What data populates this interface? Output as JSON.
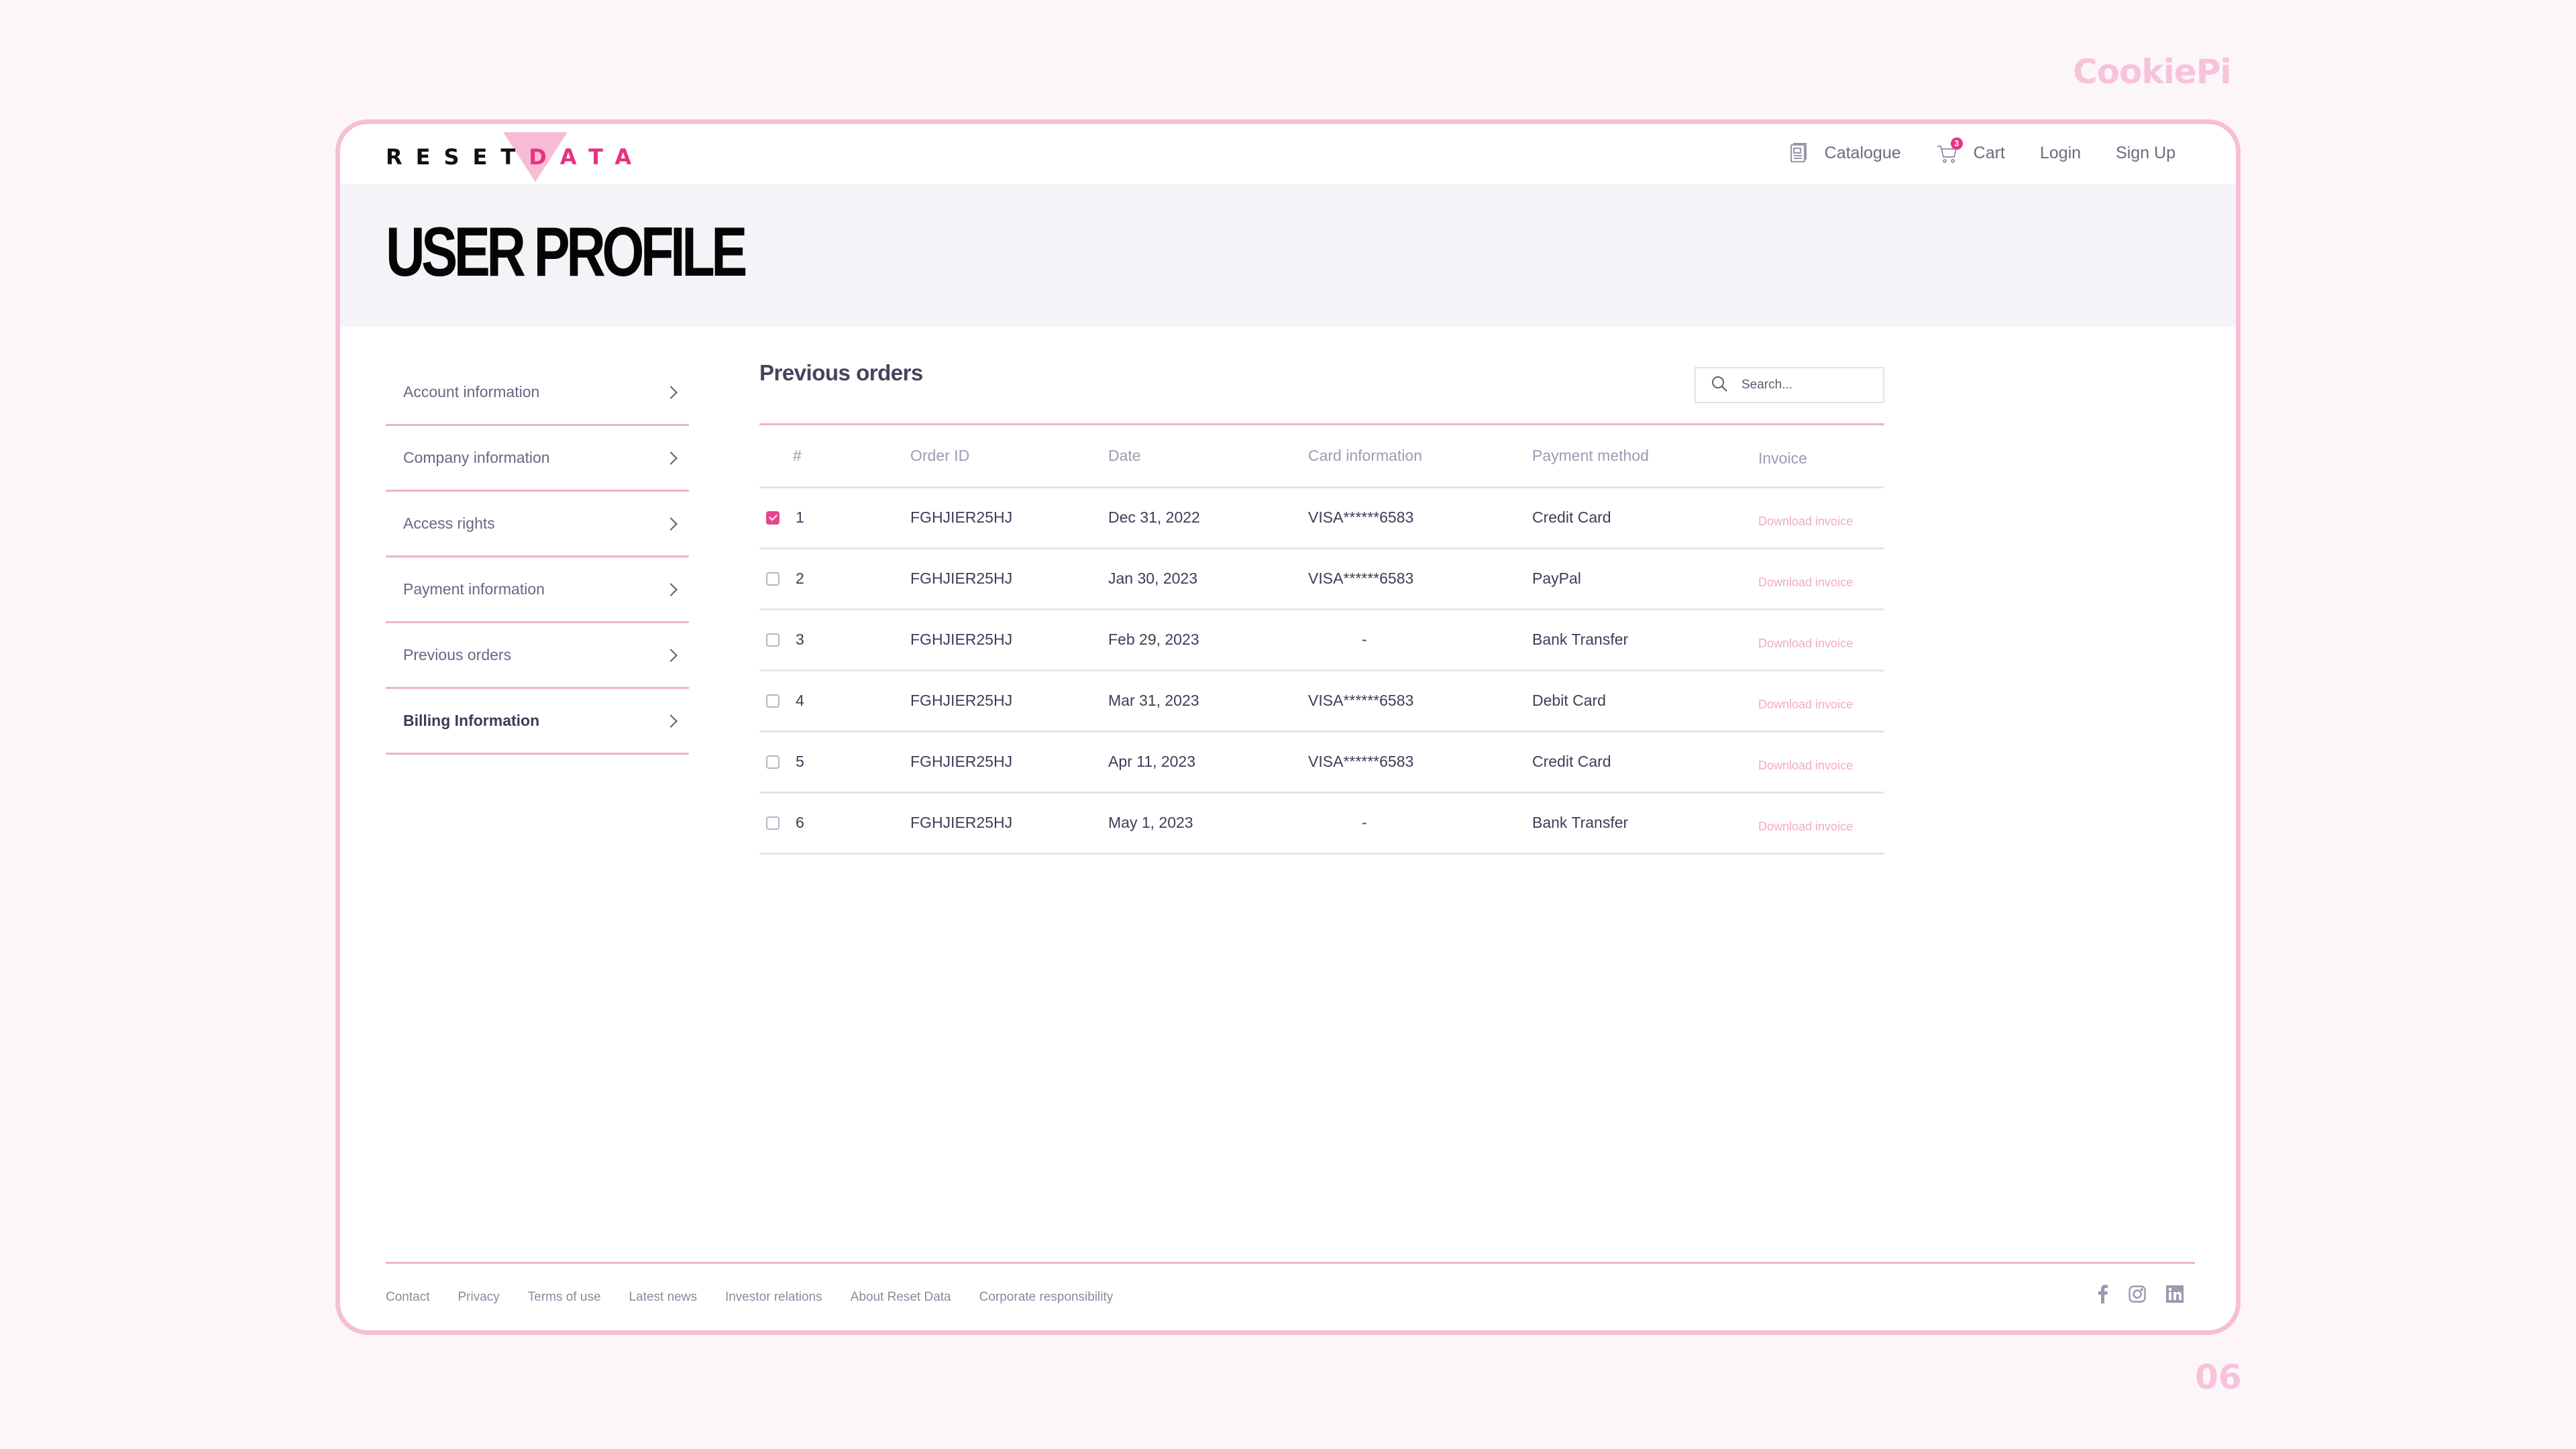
{
  "brand": "CookiePi",
  "page_number": "06",
  "logo": {
    "part1": "RESET",
    "part2": "DATA"
  },
  "nav": {
    "catalogue": "Catalogue",
    "cart": "Cart",
    "cart_count": "3",
    "login": "Login",
    "signup": "Sign Up"
  },
  "hero": {
    "title": "USER PROFILE"
  },
  "sidebar": {
    "items": [
      {
        "label": "Account information"
      },
      {
        "label": "Company information"
      },
      {
        "label": "Access rights"
      },
      {
        "label": "Payment information"
      },
      {
        "label": "Previous orders"
      },
      {
        "label": "Billing Information",
        "active": true
      }
    ]
  },
  "main": {
    "title": "Previous orders",
    "search_placeholder": "Search...",
    "columns": [
      "#",
      "Order ID",
      "Date",
      "Card information",
      "Payment method",
      "Invoice"
    ],
    "rows": [
      {
        "num": "1",
        "checked": true,
        "order_id": "FGHJIER25HJ",
        "date": "Dec 31, 2022",
        "card": "VISA******6583",
        "payment": "Credit Card",
        "invoice": "Download invoice"
      },
      {
        "num": "2",
        "checked": false,
        "order_id": "FGHJIER25HJ",
        "date": "Jan 30, 2023",
        "card": "VISA******6583",
        "payment": "PayPal",
        "invoice": "Download invoice"
      },
      {
        "num": "3",
        "checked": false,
        "order_id": "FGHJIER25HJ",
        "date": "Feb 29, 2023",
        "card": "-",
        "payment": "Bank Transfer",
        "invoice": "Download invoice"
      },
      {
        "num": "4",
        "checked": false,
        "order_id": "FGHJIER25HJ",
        "date": "Mar 31, 2023",
        "card": "VISA******6583",
        "payment": "Debit Card",
        "invoice": "Download invoice"
      },
      {
        "num": "5",
        "checked": false,
        "order_id": "FGHJIER25HJ",
        "date": "Apr 11, 2023",
        "card": "VISA******6583",
        "payment": "Credit Card",
        "invoice": "Download invoice"
      },
      {
        "num": "6",
        "checked": false,
        "order_id": "FGHJIER25HJ",
        "date": "May 1, 2023",
        "card": "-",
        "payment": "Bank Transfer",
        "invoice": "Download invoice"
      }
    ]
  },
  "footer": {
    "links": [
      "Contact",
      "Privacy",
      "Terms of use",
      "Latest news",
      "Investor relations",
      "About Reset Data",
      "Corporate responsibility"
    ],
    "social": [
      "facebook-icon",
      "instagram-icon",
      "linkedin-icon"
    ]
  },
  "colors": {
    "accent": "#e8327f",
    "frame_border": "#f6bfd7",
    "divider_pink": "#eeb3cb",
    "invoice_link": "#f2a9c8",
    "brand_watermark": "#f7c3da"
  }
}
